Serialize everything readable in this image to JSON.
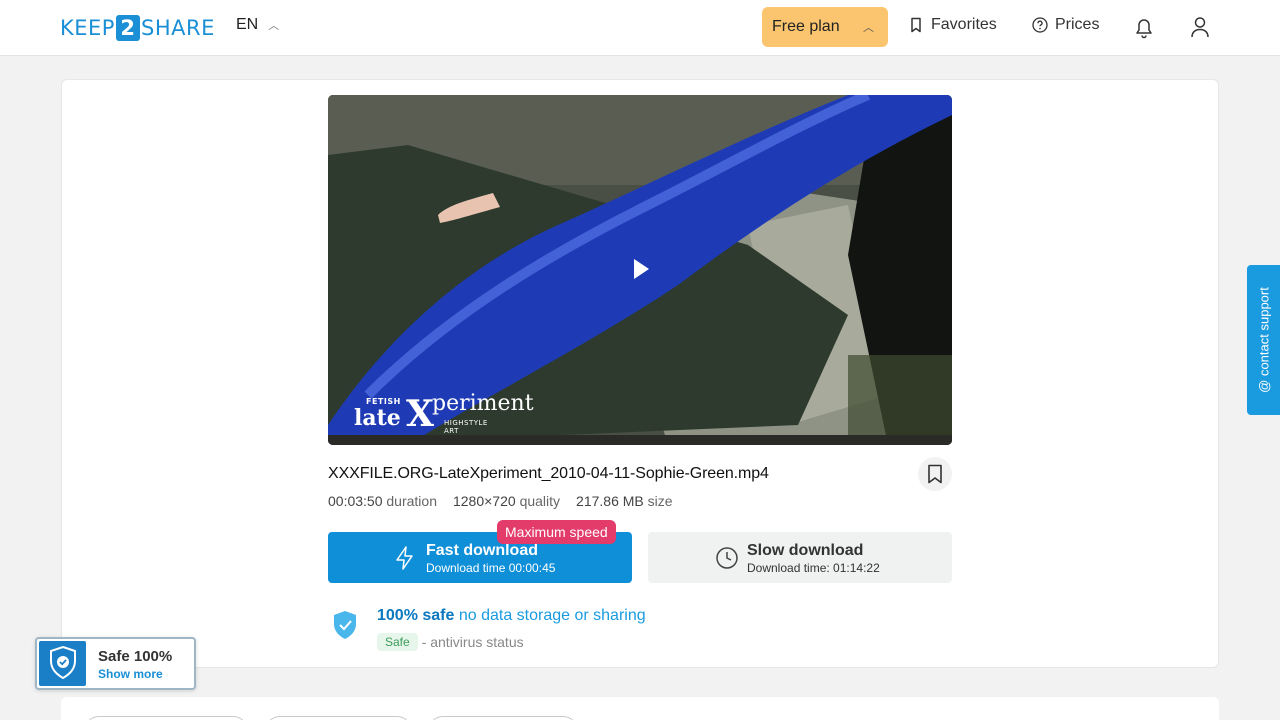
{
  "header": {
    "logo_left": "KEEP",
    "logo_number": "2",
    "logo_right": "SHARE",
    "language": "EN",
    "plan_label": "Free plan",
    "favorites_label": "Favorites",
    "prices_label": "Prices",
    "icons": {
      "favorites": "bookmark-icon",
      "prices": "question-circle-icon",
      "notifications": "bell-icon",
      "account": "user-icon"
    },
    "plan_color": "#fbc56f"
  },
  "video": {
    "watermark_small": "FETISH",
    "watermark_late": "late",
    "watermark_x": "X",
    "watermark_rest": "periment",
    "watermark_sub": "HIGHSTYLE ART"
  },
  "file": {
    "name": "XXXFILE.ORG-LateXperiment_2010-04-11-Sophie-Green.mp4",
    "duration_value": "00:03:50",
    "duration_label": "duration",
    "quality_value": "1280×720",
    "quality_label": "quality",
    "size_value": "217.86 MB",
    "size_label": "size"
  },
  "download": {
    "fast_label": "Fast download",
    "fast_time": "Download time 00:00:45",
    "fast_badge": "Maximum speed",
    "slow_label": "Slow download",
    "slow_time": "Download time: 01:14:22",
    "fast_color": "#0e8fd8",
    "badge_color": "#e33b6a"
  },
  "safety": {
    "bold": "100% safe",
    "rest": "no data storage or sharing",
    "status_tag": "Safe",
    "status_text": "- antivirus status"
  },
  "contact_support": "@ contact support",
  "safe_badge": {
    "title": "Safe 100%",
    "link": "Show more"
  }
}
